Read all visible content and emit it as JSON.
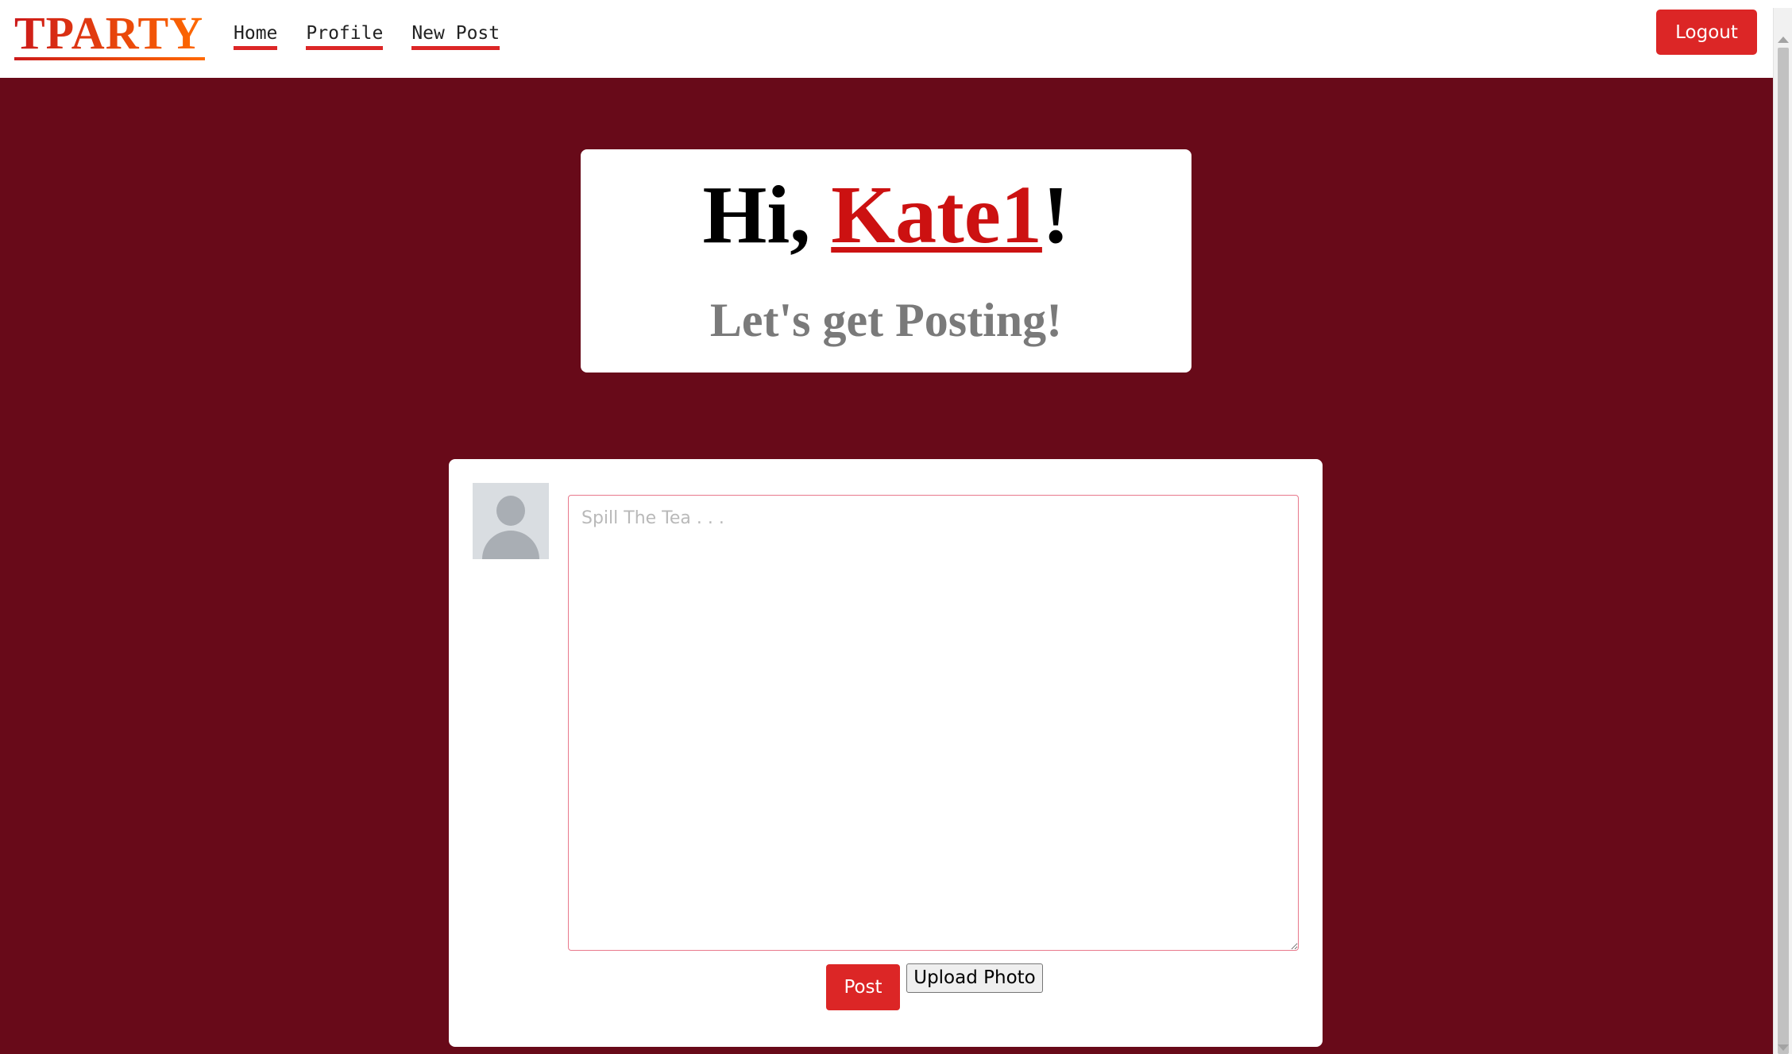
{
  "navbar": {
    "brand": "TPARTY",
    "links": [
      "Home",
      "Profile",
      "New Post"
    ],
    "logout_label": "Logout"
  },
  "greeting": {
    "prefix": "Hi, ",
    "username": "Kate1",
    "suffix": "!",
    "subtitle": "Let's get Posting!"
  },
  "composer": {
    "placeholder": "Spill The Tea . . .",
    "value": "",
    "post_label": "Post",
    "upload_label": "Upload Photo"
  },
  "colors": {
    "background": "#680a19",
    "accent": "#dc2626",
    "username": "#cc1111"
  }
}
